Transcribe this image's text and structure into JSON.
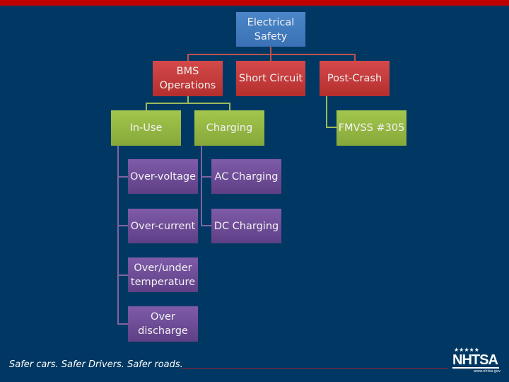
{
  "diagram": {
    "root": {
      "label": "Electrical\nSafety",
      "color": "#4a86c8"
    },
    "level2": [
      {
        "label": "BMS\nOperations",
        "color": "#c0504d"
      },
      {
        "label": "Short Circuit",
        "color": "#c0504d"
      },
      {
        "label": "Post-Crash",
        "color": "#c0504d"
      }
    ],
    "level3": [
      {
        "label": "In-Use",
        "parent": "BMS\nOperations",
        "color": "#9bbb59"
      },
      {
        "label": "Charging",
        "parent": "BMS\nOperations",
        "color": "#9bbb59"
      },
      {
        "label": "FMVSS #305",
        "parent": "Post-Crash",
        "color": "#9bbb59"
      }
    ],
    "level4_in_use": [
      {
        "label": "Over-voltage"
      },
      {
        "label": "Over-current"
      },
      {
        "label": "Over/under\ntemperature"
      },
      {
        "label": "Over\ndischarge"
      }
    ],
    "level4_charging": [
      {
        "label": "AC Charging"
      },
      {
        "label": "DC Charging"
      }
    ],
    "level4_color": "#8064a2"
  },
  "footer": {
    "tagline": "Safer cars. Safer Drivers. Safer roads.",
    "logo": {
      "stars": "★★★★★",
      "name": "NHTSA",
      "url": "www.nhtsa.gov"
    }
  },
  "colors": {
    "background": "#003863",
    "top_bar": "#c00000"
  }
}
